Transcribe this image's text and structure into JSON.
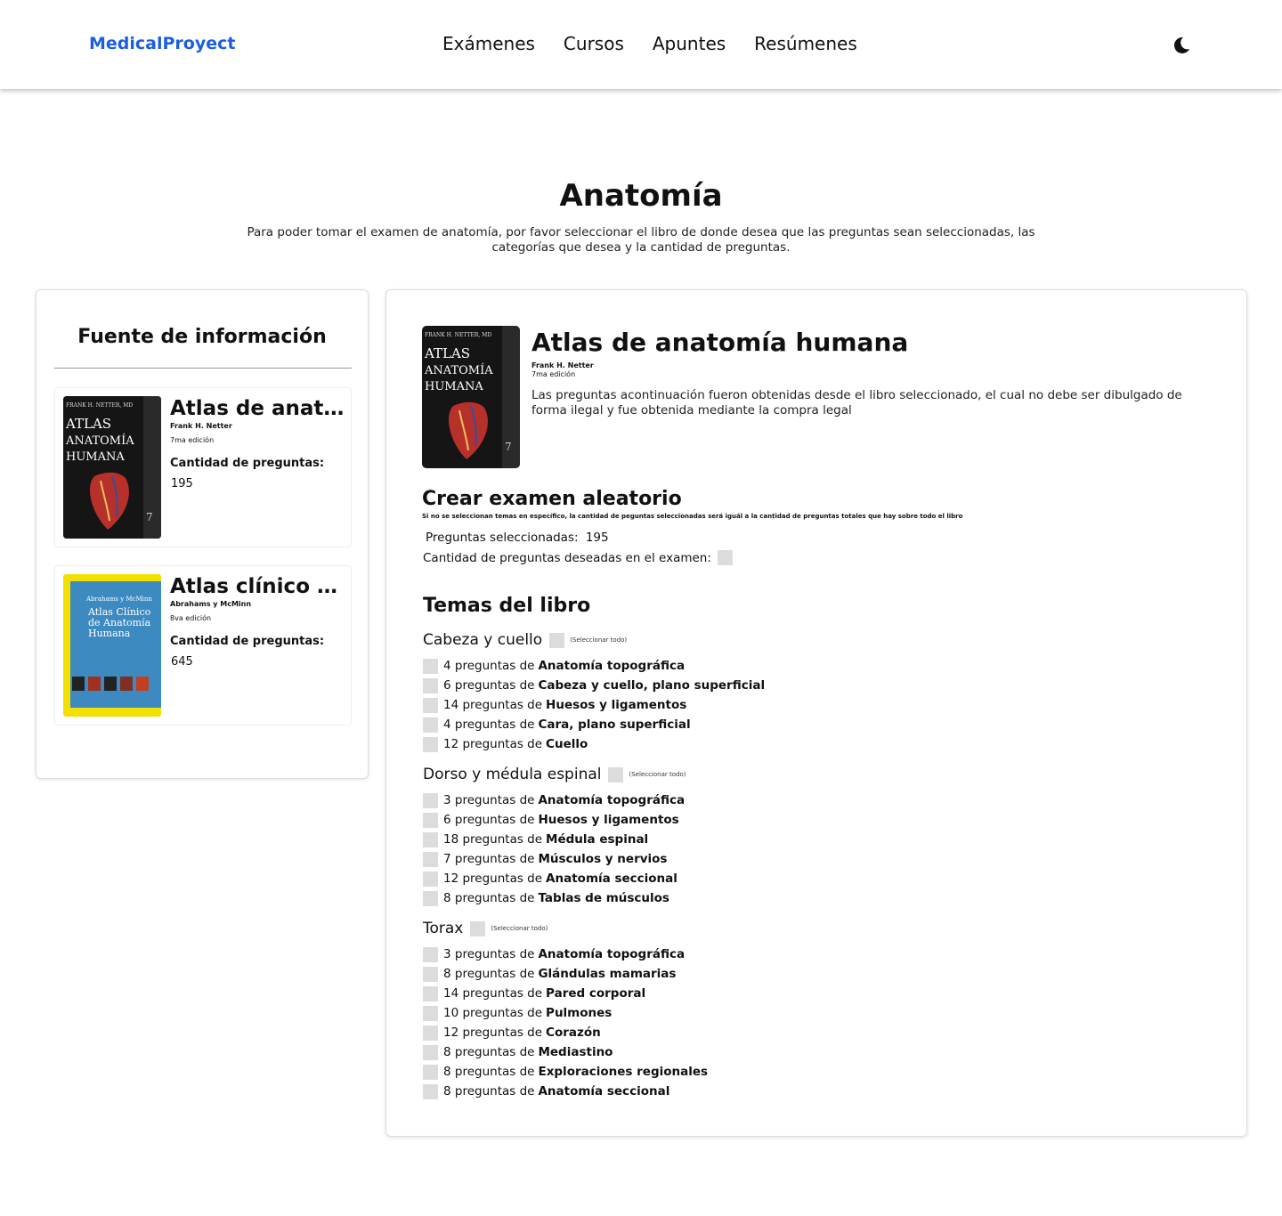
{
  "header": {
    "brand": "MedicalProyect",
    "nav": [
      "Exámenes",
      "Cursos",
      "Apuntes",
      "Resúmenes"
    ],
    "theme_icon": "moon-icon"
  },
  "page": {
    "title": "Anatomía",
    "description": "Para poder tomar el examen de anatomía, por favor seleccionar el libro de donde desea que las preguntas sean seleccionadas, las categorías que desea y la cantidad de preguntas."
  },
  "sources": {
    "title": "Fuente de información",
    "books": [
      {
        "name": "Atlas de anatomía humana",
        "author": "Frank H. Netter",
        "edition": "7ma edición",
        "questions_label": "Cantidad de preguntas:",
        "questions": "195",
        "cover_color": "#151515"
      },
      {
        "name": "Atlas clínico de anatomía humana",
        "author": "Abrahams y McMinn",
        "edition": "8va edición",
        "questions_label": "Cantidad de preguntas:",
        "questions": "645",
        "cover_color": "#3c8ac0"
      }
    ]
  },
  "main": {
    "book_title": "Atlas de anatomía humana",
    "author": "Frank H. Netter",
    "edition": "7ma edición",
    "description": "Las preguntas acontinuación fueron obtenidas desde el libro seleccionado, el cual no debe ser dibulgado de forma ilegal y fue obtenida mediante la compra legal",
    "exam": {
      "title": "Crear examen aleatorio",
      "note": "Si no se seleccionan temas en específico, la cantidad de peguntas seleccionadas será iguál a la cantidad de preguntas totales que hay sobre todo el libro",
      "selected_label": "Preguntas seleccionadas:",
      "selected_value": "195",
      "wanted_label": "Cantidad de preguntas deseadas en el examen:"
    },
    "topics_title": "Temas del libro",
    "select_all_label": "(Seleccionar todo)",
    "sections": [
      {
        "name": "Cabeza y cuello",
        "topics": [
          {
            "count": "4 preguntas de",
            "name": "Anatomía topográfica"
          },
          {
            "count": "6 preguntas de",
            "name": "Cabeza y cuello, plano superficial"
          },
          {
            "count": "14 preguntas de",
            "name": "Huesos y ligamentos"
          },
          {
            "count": "4 preguntas de",
            "name": "Cara, plano superficial"
          },
          {
            "count": "12 preguntas de",
            "name": "Cuello"
          }
        ]
      },
      {
        "name": "Dorso y médula espinal",
        "topics": [
          {
            "count": "3 preguntas de",
            "name": "Anatomía topográfica"
          },
          {
            "count": "6 preguntas de",
            "name": "Huesos y ligamentos"
          },
          {
            "count": "18 preguntas de",
            "name": "Médula espinal"
          },
          {
            "count": "7 preguntas de",
            "name": "Músculos y nervios"
          },
          {
            "count": "12 preguntas de",
            "name": "Anatomía seccional"
          },
          {
            "count": "8 preguntas de",
            "name": "Tablas de músculos"
          }
        ]
      },
      {
        "name": "Torax",
        "topics": [
          {
            "count": "3 preguntas de",
            "name": "Anatomía topográfica"
          },
          {
            "count": "8 preguntas de",
            "name": "Glándulas mamarias"
          },
          {
            "count": "14 preguntas de",
            "name": "Pared corporal"
          },
          {
            "count": "10 preguntas de",
            "name": "Pulmones"
          },
          {
            "count": "12 preguntas de",
            "name": "Corazón"
          },
          {
            "count": "8 preguntas de",
            "name": "Mediastino"
          },
          {
            "count": "8 preguntas de",
            "name": "Exploraciones regionales"
          },
          {
            "count": "8 preguntas de",
            "name": "Anatomía seccional"
          }
        ]
      }
    ]
  }
}
